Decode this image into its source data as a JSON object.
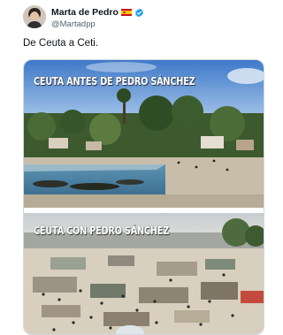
{
  "tweet": {
    "author": {
      "display_name": "Marta de Pedro",
      "handle": "@Martadpp",
      "flag": "spain-flag",
      "verified_badge": "verified-badge-icon",
      "colors": {
        "verified": "#1d9bf0",
        "flag_red": "#c60b1e",
        "flag_yellow": "#ffc400"
      }
    },
    "text": "De Ceuta a Ceti.",
    "media": {
      "image_top": {
        "caption": "CEUTA ANTES DE PEDRO SÁNCHEZ"
      },
      "image_bottom": {
        "caption": "CEUTA CON PEDRO SÁNCHEZ"
      }
    }
  }
}
